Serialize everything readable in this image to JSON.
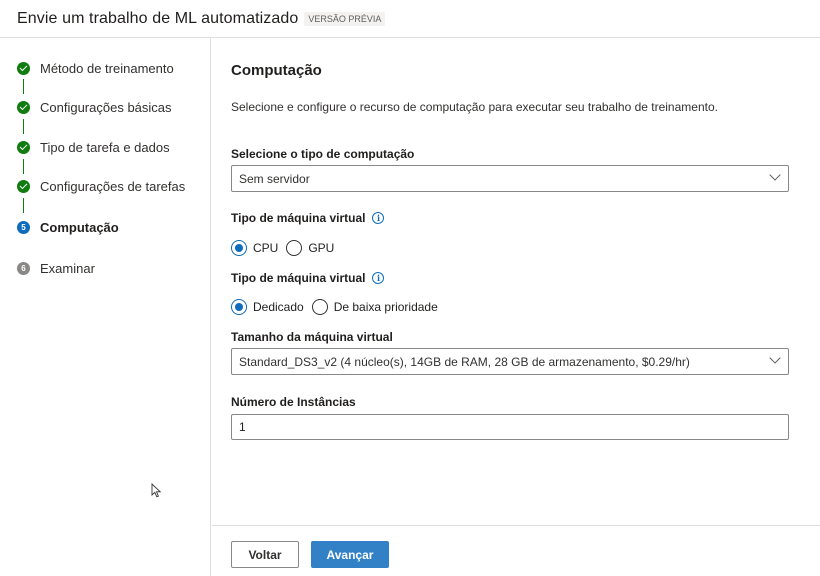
{
  "header": {
    "title": "Envie um trabalho de ML automatizado",
    "badge": "VERSÃO PRÉVIA"
  },
  "steps": [
    {
      "label": "Método de treinamento",
      "status": "done"
    },
    {
      "label": "Configurações básicas",
      "status": "done"
    },
    {
      "label": "Tipo de tarefa e dados",
      "status": "done"
    },
    {
      "label": "Configurações de tarefas",
      "status": "done"
    },
    {
      "label": "Computação",
      "status": "active",
      "number": "5"
    },
    {
      "label": "Examinar",
      "status": "pending",
      "number": "6"
    }
  ],
  "main": {
    "title": "Computação",
    "description": "Selecione e configure o recurso de computação para executar seu trabalho de treinamento.",
    "compute_type": {
      "label": "Selecione o tipo de computação",
      "value": "Sem servidor"
    },
    "vm_type": {
      "label": "Tipo de máquina virtual",
      "options": [
        "CPU",
        "GPU"
      ],
      "selected": "CPU"
    },
    "vm_priority": {
      "label": "Tipo de máquina virtual",
      "options": [
        "Dedicado",
        "De baixa prioridade"
      ],
      "selected": "Dedicado"
    },
    "vm_size": {
      "label": "Tamanho da máquina virtual",
      "value": "Standard_DS3_v2 (4 núcleo(s), 14GB de RAM, 28 GB de armazenamento, $0.29/hr)"
    },
    "instances": {
      "label": "Número de Instâncias",
      "value": "1"
    }
  },
  "footer": {
    "back_label": "Voltar",
    "next_label": "Avançar"
  },
  "colors": {
    "done": "#107c10",
    "accent": "#0f6cbd",
    "pending": "#8a8886"
  }
}
